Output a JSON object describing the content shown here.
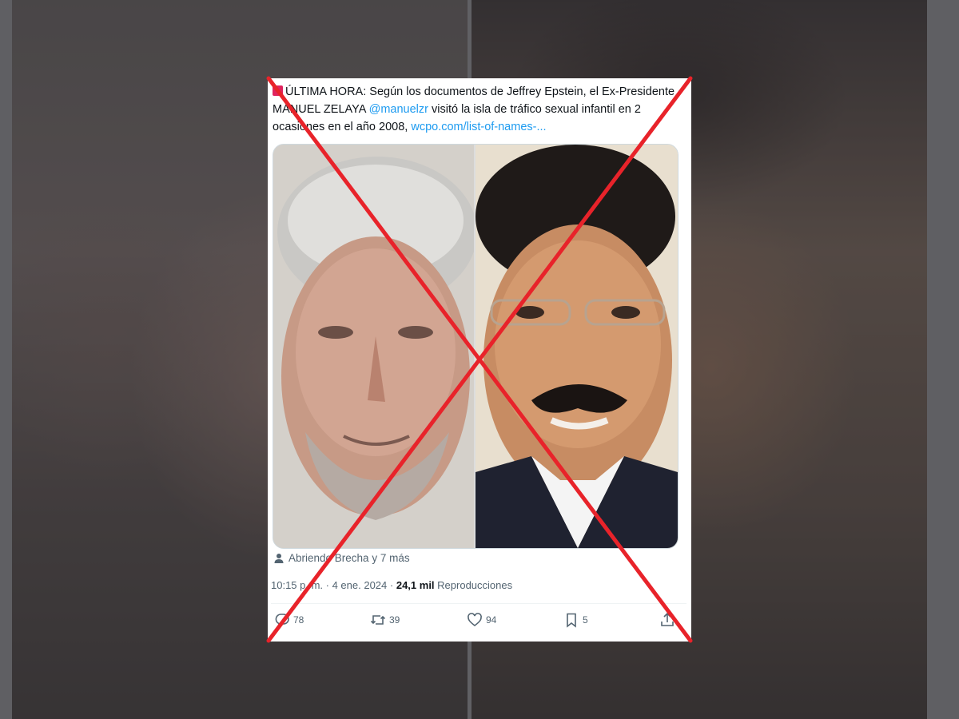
{
  "tweet": {
    "text_headline": "ÚLTIMA HORA: Según los documentos de Jeffrey Epstein, el Ex-Presidente MANUEL ZELAYA",
    "mention": "@manuelzr",
    "text_rest": "visitó la isla de tráfico sexual infantil en 2 ocasiones en el año 2008,",
    "link": "wcpo.com/list-of-names-...",
    "audience": "Abriendo Brecha y 7 más",
    "time": "10:15 p. m. · 4 ene. 2024 ·",
    "views_count": "24,1 mil",
    "views_label": "Reproducciones",
    "actions": {
      "replies": "78",
      "reposts": "39",
      "likes": "94",
      "bookmarks": "5"
    }
  },
  "colors": {
    "accent": "#1d9bf0",
    "cross": "#e8232a",
    "text": "#0f1419",
    "secondary": "#536471"
  },
  "icons": {
    "alert": "alert-icon",
    "audience": "person-icon",
    "reply": "reply-icon",
    "repost": "repost-icon",
    "like": "heart-icon",
    "bookmark": "bookmark-icon",
    "share": "share-icon",
    "overlay": "red-x-icon"
  }
}
